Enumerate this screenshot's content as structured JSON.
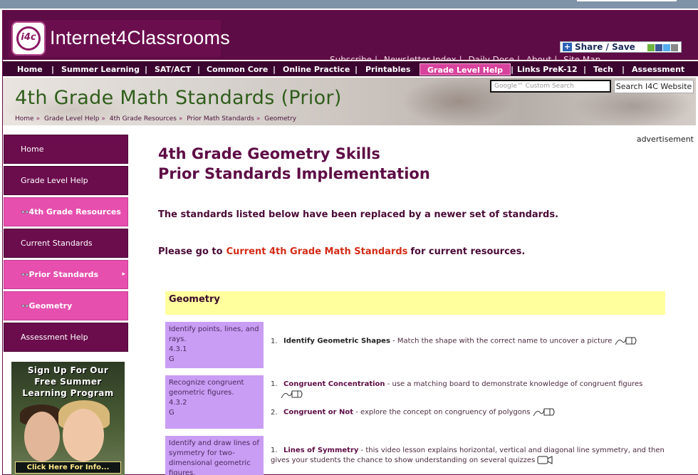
{
  "site": {
    "name": "Internet4Classrooms",
    "logo_mark": "i4c",
    "top_links": [
      "Subscribe",
      "Newsletter Index",
      "Daily Dose",
      "About",
      "Site Map"
    ],
    "share_label": "Share / Save"
  },
  "nav": {
    "items": [
      "Home",
      "Summer Learning",
      "SAT/ACT",
      "Common Core",
      "Online Practice",
      "Printables",
      "Grade Level Help",
      "Links PreK-12",
      "Tech",
      "Assessment"
    ],
    "active": "Grade Level Help"
  },
  "banner": {
    "title": "4th Grade Math Standards (Prior)",
    "breadcrumb": [
      "Home",
      "Grade Level Help",
      "4th Grade Resources",
      "Prior Math Standards",
      "Geometry"
    ],
    "search_placeholder": "Google™ Custom Search",
    "search_button": "Search I4C Website"
  },
  "sidebar": {
    "items": [
      {
        "label": "Home",
        "style": "dark"
      },
      {
        "label": "Grade Level Help",
        "style": "dark"
      },
      {
        "label": "4th Grade Resources",
        "style": "pink"
      },
      {
        "label": "Current Standards",
        "style": "dark"
      },
      {
        "label": "Prior Standards",
        "style": "pink"
      },
      {
        "label": "Geometry",
        "style": "pink"
      },
      {
        "label": "Assessment Help",
        "style": "dark"
      }
    ],
    "promo": {
      "lines": [
        "Sign Up For Our",
        "Free Summer",
        "Learning Program"
      ],
      "cta": "Click Here For Info..."
    }
  },
  "ad_label": "advertisement",
  "main": {
    "title_line1": "4th Grade Geometry Skills",
    "title_line2": "Prior Standards Implementation",
    "notice": "The standards listed below have been replaced by a newer set of standards.",
    "goto_prefix": "Please go to",
    "goto_link": "Current 4th Grade Math Standards",
    "goto_suffix": "for current resources.",
    "section_heading": "Geometry",
    "standards": [
      {
        "text": "Identify points, lines, and rays.",
        "code": "4.3.1",
        "level": "G",
        "resources": [
          {
            "num": "1.",
            "title": "Identify Geometric Shapes",
            "desc": " - Match the shape with the correct name to uncover a picture"
          }
        ]
      },
      {
        "text": "Recognize congruent geometric figures.",
        "code": "4.3.2",
        "level": "G",
        "resources": [
          {
            "num": "1.",
            "title": "Congruent Concentration",
            "desc": "  - use a matching board to demonstrate knowledge of congruent figures"
          },
          {
            "num": "2.",
            "title": "Congruent or Not",
            "desc": "  - explore the concept on congruency of polygons"
          }
        ]
      },
      {
        "text": "Identify and draw lines of symmetry for two-dimensional geometric figures.",
        "code": "",
        "level": "",
        "resources": [
          {
            "num": "1.",
            "title": "Lines of Symmetry",
            "desc": " - this video lesson explains horizontal, vertical and diagonal line symmetry, and then gives your students the chance to show understanding on several quizzes"
          }
        ]
      }
    ]
  },
  "colors": {
    "brand_purple": "#5e0c45",
    "nav_bg": "#3b0530",
    "pink": "#e74fae",
    "link_red": "#d42b16",
    "standard_box": "#c99df4",
    "section_yellow": "#ffff9e"
  },
  "icons": [
    "share-plus-icon",
    "pencil-activity-icon",
    "glasses-icon",
    "chevron-right-icon",
    "video-icon"
  ]
}
